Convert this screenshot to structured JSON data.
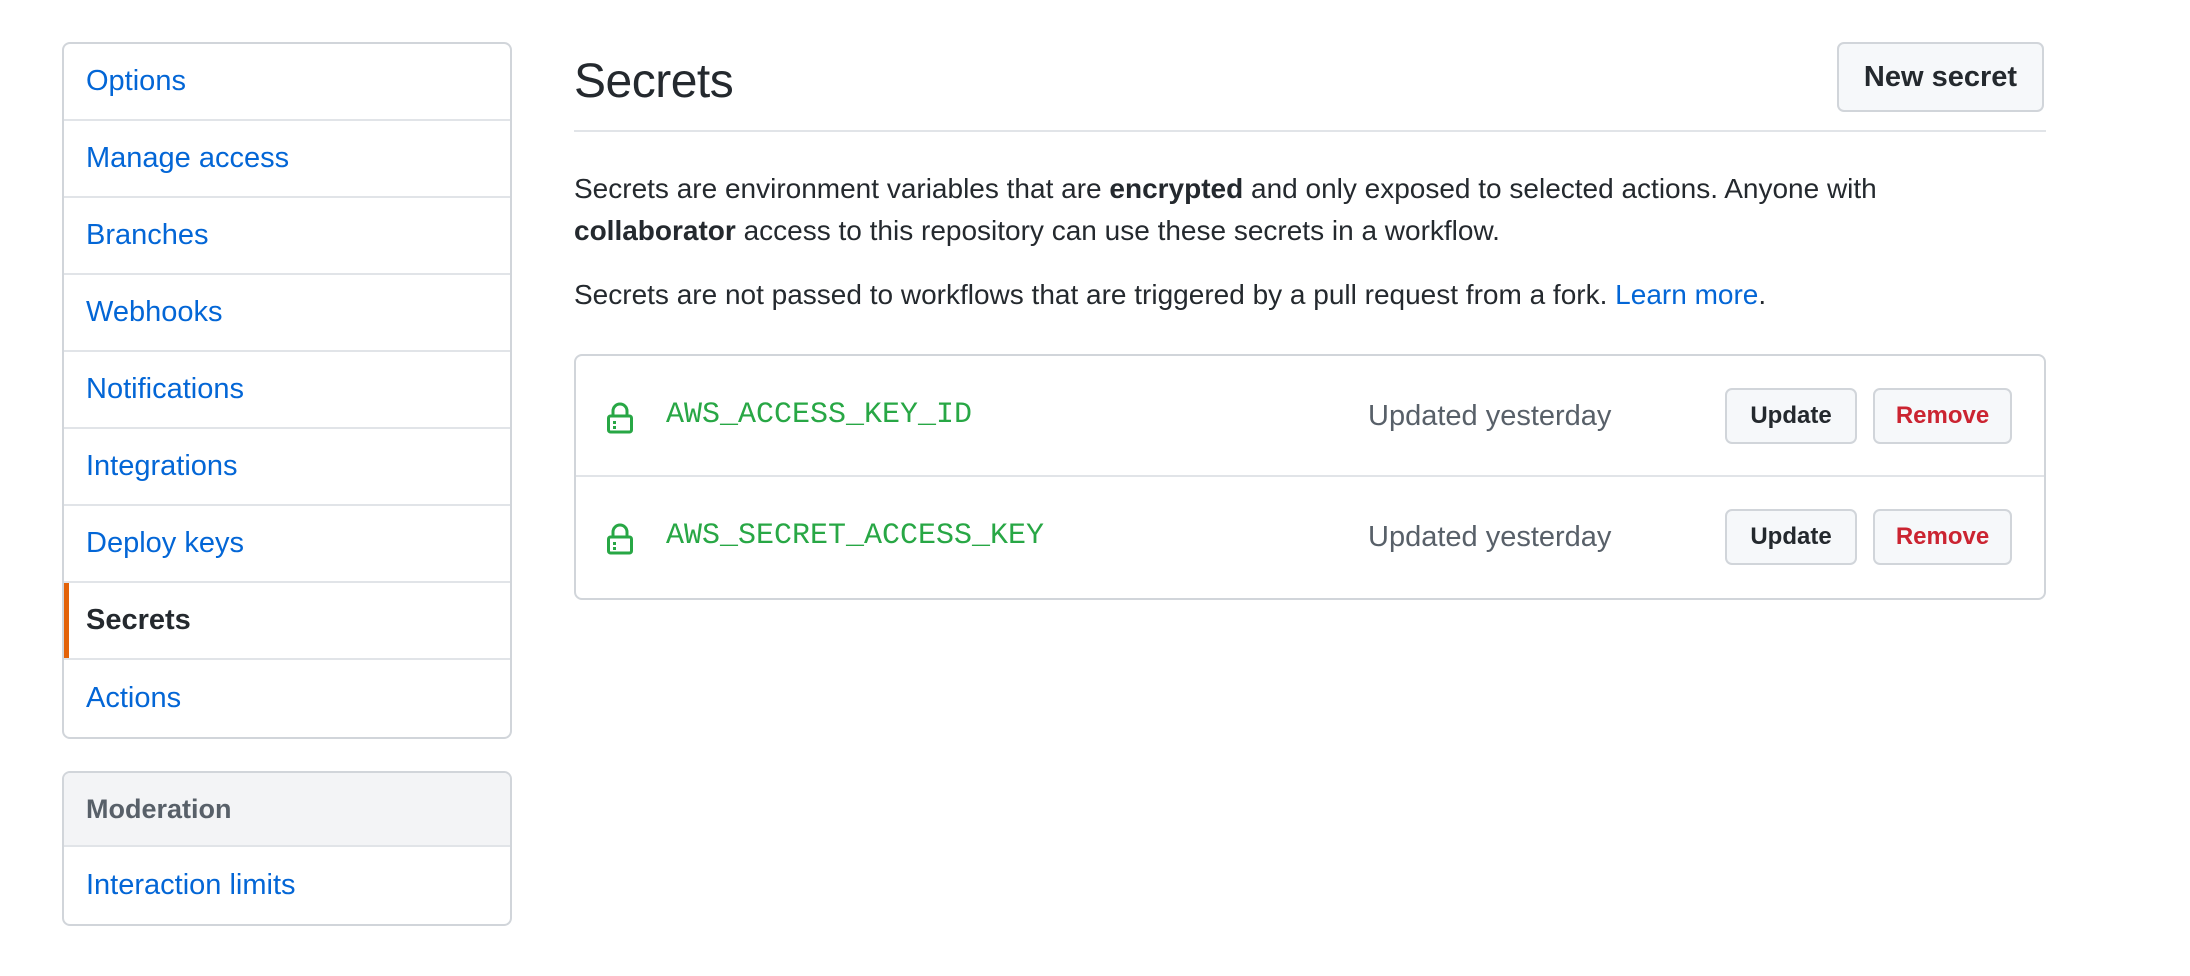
{
  "sidebar": {
    "items": [
      {
        "label": "Options"
      },
      {
        "label": "Manage access"
      },
      {
        "label": "Branches"
      },
      {
        "label": "Webhooks"
      },
      {
        "label": "Notifications"
      },
      {
        "label": "Integrations"
      },
      {
        "label": "Deploy keys"
      },
      {
        "label": "Secrets",
        "selected": true
      },
      {
        "label": "Actions"
      }
    ],
    "moderation": {
      "heading": "Moderation",
      "items": [
        {
          "label": "Interaction limits"
        }
      ]
    }
  },
  "main": {
    "title": "Secrets",
    "new_secret_label": "New secret",
    "description": {
      "part1": "Secrets are environment variables that are ",
      "bold1": "encrypted",
      "part2": " and only exposed to selected actions. Anyone with ",
      "bold2": "collaborator",
      "part3": " access to this repository can use these secrets in a workflow."
    },
    "fork_note": {
      "text": "Secrets are not passed to workflows that are triggered by a pull request from a fork. ",
      "link": "Learn more",
      "suffix": "."
    },
    "secrets": [
      {
        "name": "AWS_ACCESS_KEY_ID",
        "updated": "Updated yesterday",
        "update_label": "Update",
        "remove_label": "Remove",
        "icon": "lock-icon"
      },
      {
        "name": "AWS_SECRET_ACCESS_KEY",
        "updated": "Updated yesterday",
        "update_label": "Update",
        "remove_label": "Remove",
        "icon": "lock-icon"
      }
    ]
  },
  "colors": {
    "link": "#0366d6",
    "selected_accent": "#e36209",
    "secret_name": "#28a745",
    "remove": "#cb2431"
  }
}
